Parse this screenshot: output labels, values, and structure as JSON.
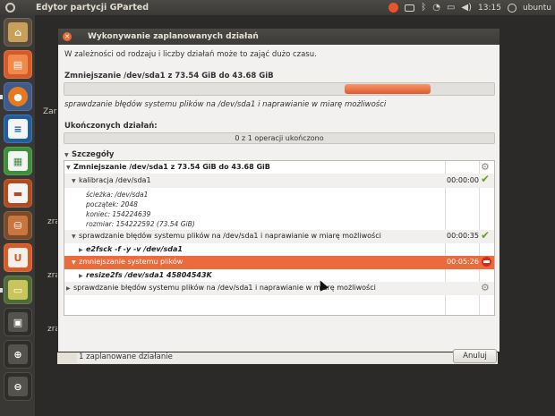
{
  "topbar": {
    "app_title": "Edytor partycji GParted",
    "clock": "13:15",
    "user": "ubuntu"
  },
  "launcher": {
    "items": [
      "dash-home-icon",
      "files-icon",
      "firefox-icon",
      "writer-icon",
      "calc-icon",
      "impress-icon",
      "software-center-icon",
      "ubuntu-one-icon",
      "gparted-icon",
      "workspace-switcher-icon",
      "magnifier-icon",
      "magnifier-icon-2"
    ]
  },
  "background": {
    "labels": [
      "Zar",
      "zra",
      "zra",
      "zra"
    ],
    "status": "1 zaplanowane działanie"
  },
  "dialog": {
    "title": "Wykonywanie zaplanowanych działań",
    "info": "W zależności od rodzaju i liczby działań może to zająć dużo czasu.",
    "current_operation": "Zmniejszanie /dev/sda1 z 73.54 GiB do 43.68 GiB",
    "current_progress": 0.5,
    "sub_operation": "sprawdzanie błędów systemu plików na /dev/sda1 i naprawianie w miarę możliwości",
    "completed_label": "Ukończonych działań:",
    "completed_text": "0 z 1 operacji ukończono",
    "completed_progress": 0,
    "details_label": "Szczegóły",
    "cancel_label": "Anuluj",
    "tree": {
      "root": "Zmniejszanie /dev/sda1 z 73.54 GiB do 43.68 GiB",
      "calibrate": "kalibracja /dev/sda1",
      "calibrate_time": "00:00:00",
      "details": [
        "ścieżka: /dev/sda1",
        "początek: 2048",
        "koniec: 154224639",
        "rozmiar: 154222592 (73.54 GiB)"
      ],
      "check": "sprawdzanie błędów systemu plików na /dev/sda1 i naprawianie w miarę możliwości",
      "check_time": "00:00:35",
      "check_cmd": "e2fsck -f -y -v /dev/sda1",
      "shrink": "zmniejszanie systemu plików",
      "shrink_time": "00:05:26",
      "shrink_cmd": "resize2fs /dev/sda1 45804543K",
      "check2": "sprawdzanie błędów systemu plików na /dev/sda1 i naprawianie w miarę możliwości"
    }
  },
  "colors": {
    "accent": "#ea6b3c",
    "progress": "#e2582a",
    "ok": "#66a21a",
    "error": "#d52b1e"
  }
}
